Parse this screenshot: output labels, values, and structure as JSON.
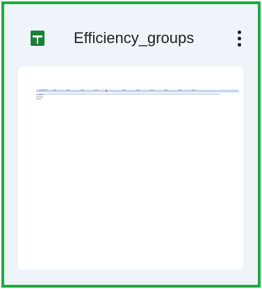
{
  "file": {
    "title": "Efficiency_groups",
    "type_icon": "google-sheets-icon",
    "menu_icon": "more-vert-icon"
  },
  "colors": {
    "selection_border": "#1aad3c",
    "card_background": "#eff3fa",
    "sheets_green": "#188038",
    "preview_header": "#c8d9f5"
  }
}
